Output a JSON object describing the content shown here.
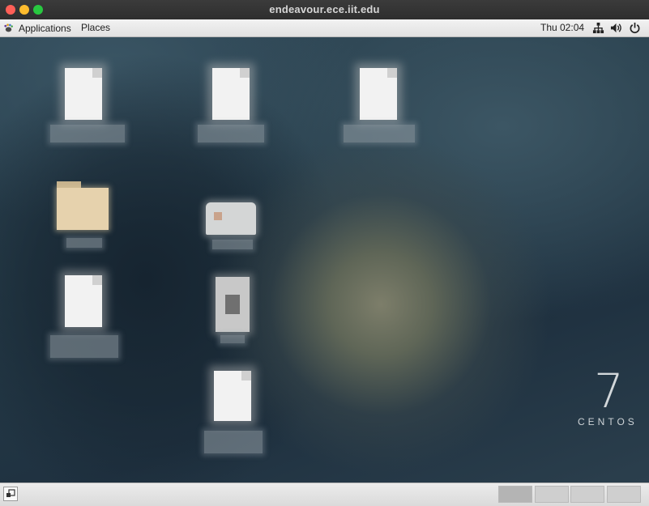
{
  "window": {
    "title": "endeavour.ece.iit.edu"
  },
  "top_panel": {
    "applications_label": "Applications",
    "places_label": "Places",
    "clock": "Thu 02:04",
    "tray_icons": [
      "network-icon",
      "volume-icon",
      "power-icon"
    ]
  },
  "desktop": {
    "icons": [
      {
        "type": "document",
        "label": ""
      },
      {
        "type": "document",
        "label": ""
      },
      {
        "type": "document",
        "label": ""
      },
      {
        "type": "folder",
        "label": ""
      },
      {
        "type": "drive",
        "label": ""
      },
      {
        "type": "document",
        "label": ""
      },
      {
        "type": "cdrom",
        "label": ""
      },
      {
        "type": "document",
        "label": ""
      }
    ],
    "branding": {
      "number": "7",
      "word": "CENTOS"
    }
  },
  "bottom_panel": {
    "show_desktop_icon": "show-desktop-icon",
    "workspaces": [
      {
        "active": true
      },
      {
        "active": false
      },
      {
        "active": false
      },
      {
        "active": false
      }
    ]
  },
  "colors": {
    "panel": "#e6e6e6",
    "desktop_base": "#253b48",
    "close": "#ff5f57",
    "minimize": "#febc2e",
    "maximize": "#28c840"
  }
}
